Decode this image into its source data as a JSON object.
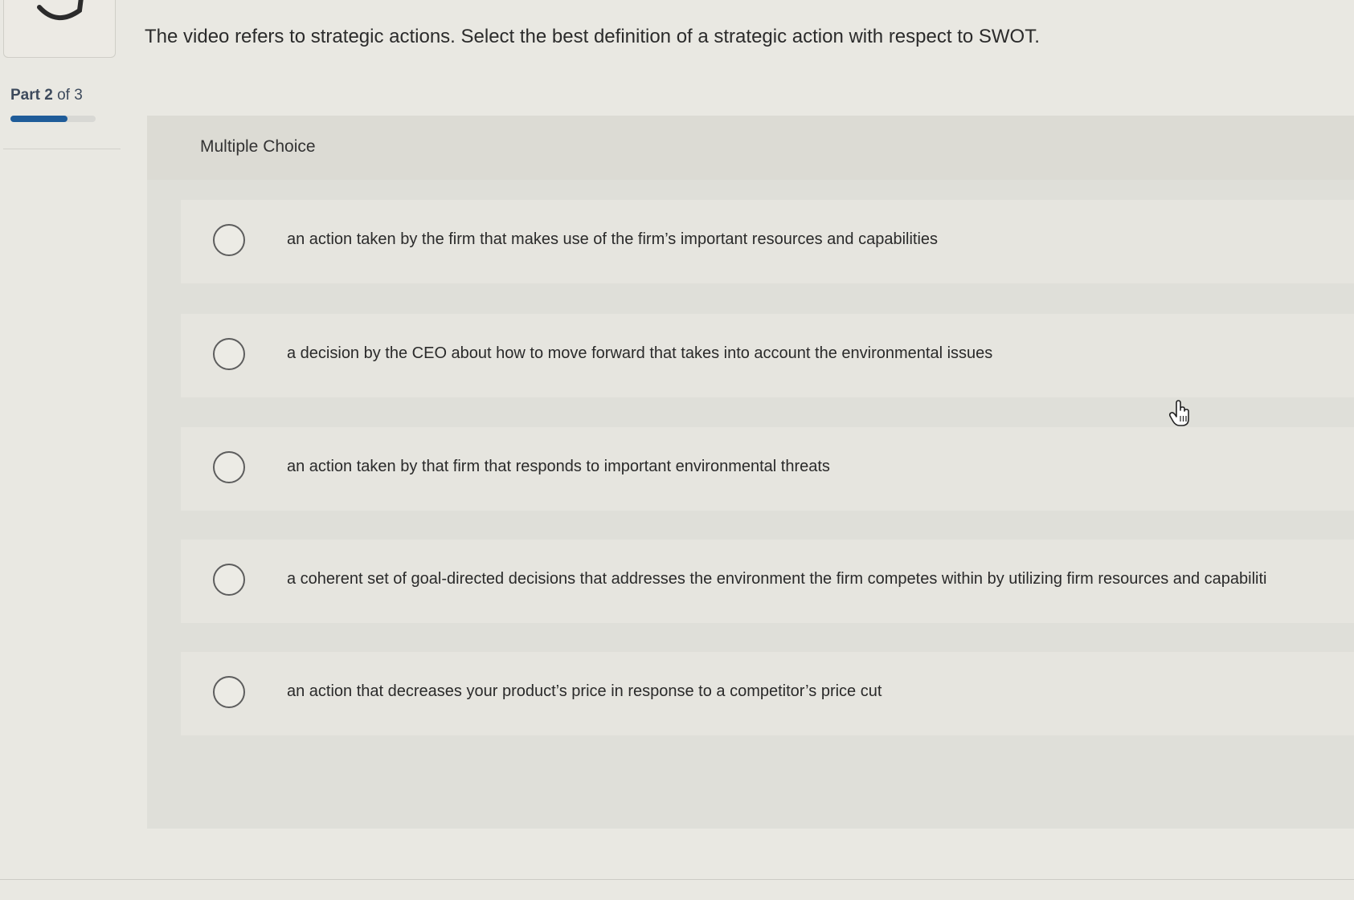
{
  "sidebar": {
    "part_word": "Part",
    "part_current": "2",
    "part_of": "of",
    "part_total": "3",
    "progress_fraction": 0.667
  },
  "question": {
    "text": "The video refers to strategic actions. Select the best definition of a strategic action with respect to SWOT."
  },
  "multiple_choice": {
    "title": "Multiple Choice",
    "options": [
      {
        "label": "an action taken by the firm that makes use of the firm’s important resources and capabilities",
        "selected": false
      },
      {
        "label": "a decision by the CEO about how to move forward that takes into account the environmental issues",
        "selected": false
      },
      {
        "label": "an action taken by that firm that responds to important environmental threats",
        "selected": false
      },
      {
        "label": "a coherent set of goal-directed decisions that addresses the environment the firm competes within by utilizing firm resources and capabiliti",
        "selected": false
      },
      {
        "label": "an action that decreases your product’s price in response to a competitor’s price cut",
        "selected": false
      }
    ]
  },
  "colors": {
    "accent": "#1f5c99",
    "background": "#e9e8e2"
  },
  "icons": {
    "previous_item": "undo-arrow-icon",
    "pointer": "hand-pointer-icon"
  }
}
